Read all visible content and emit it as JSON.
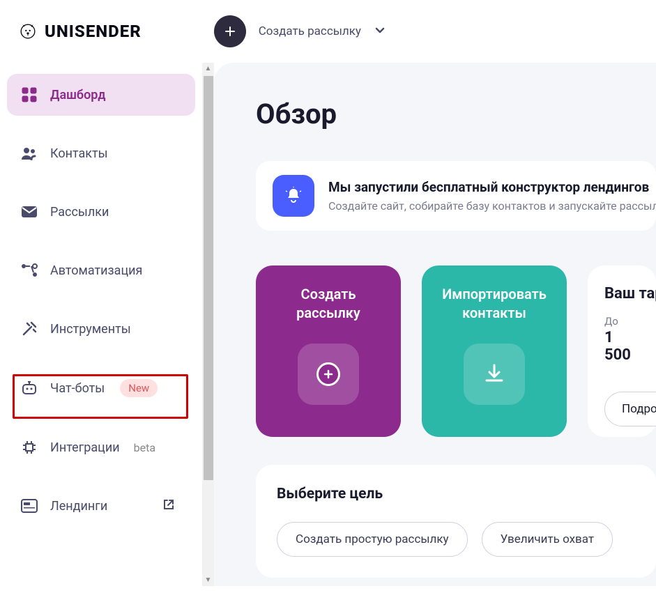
{
  "header": {
    "brand": "UNISENDER",
    "create_button_label": "Создать рассылку"
  },
  "sidebar": {
    "items": [
      {
        "label": "Дашборд",
        "icon": "dashboard-icon",
        "active": true
      },
      {
        "label": "Контакты",
        "icon": "contacts-icon"
      },
      {
        "label": "Рассылки",
        "icon": "mailings-icon"
      },
      {
        "label": "Автоматизация",
        "icon": "automation-icon"
      },
      {
        "label": "Инструменты",
        "icon": "tools-icon"
      },
      {
        "label": "Чат-боты",
        "icon": "chatbots-icon",
        "badge_new": "New",
        "highlighted": true
      },
      {
        "label": "Интеграции",
        "icon": "integrations-icon",
        "badge_beta": "beta"
      },
      {
        "label": "Лендинги",
        "icon": "landings-icon",
        "external": true
      }
    ]
  },
  "main": {
    "title": "Обзор",
    "banner": {
      "title": "Мы запустили бесплатный конструктор лендингов",
      "subtitle": "Создайте сайт, собирайте базу контактов и запускайте рассылки"
    },
    "cards": {
      "create": "Создать рассылку",
      "import": "Импортировать контакты"
    },
    "tariff": {
      "title": "Ваш тариф",
      "until_label": "До",
      "value": "1 500",
      "button": "Подробнее"
    },
    "goals": {
      "title": "Выберите цель",
      "chips": [
        "Создать простую рассылку",
        "Увеличить охват"
      ]
    }
  }
}
